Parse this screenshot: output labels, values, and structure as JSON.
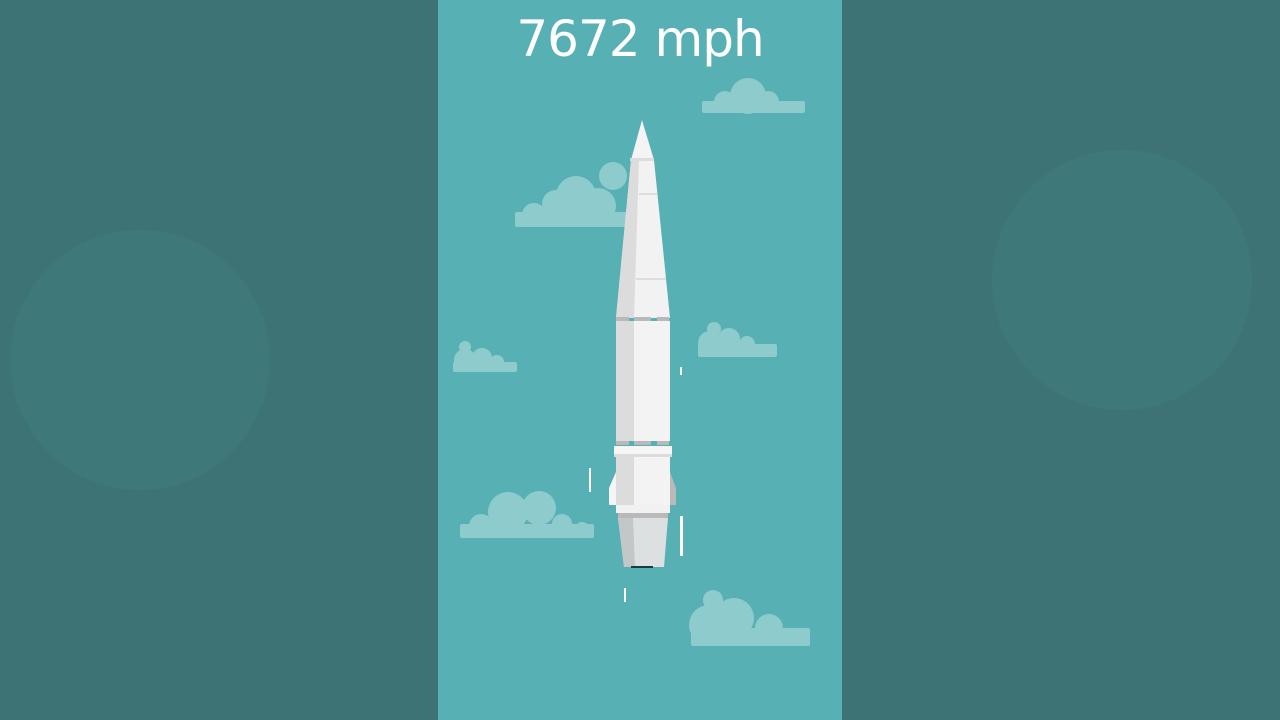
{
  "video": {
    "speed_readout": "7672 mph"
  },
  "colors": {
    "background_outer": "#3d7374",
    "sky": "#57b0b3",
    "cloud": "#8ecbcd",
    "rocket_body": "#f2f2f2",
    "rocket_shade": "#dcdcdc",
    "rocket_detail": "#b9b9b9",
    "speed_lines": "#ffffff"
  }
}
